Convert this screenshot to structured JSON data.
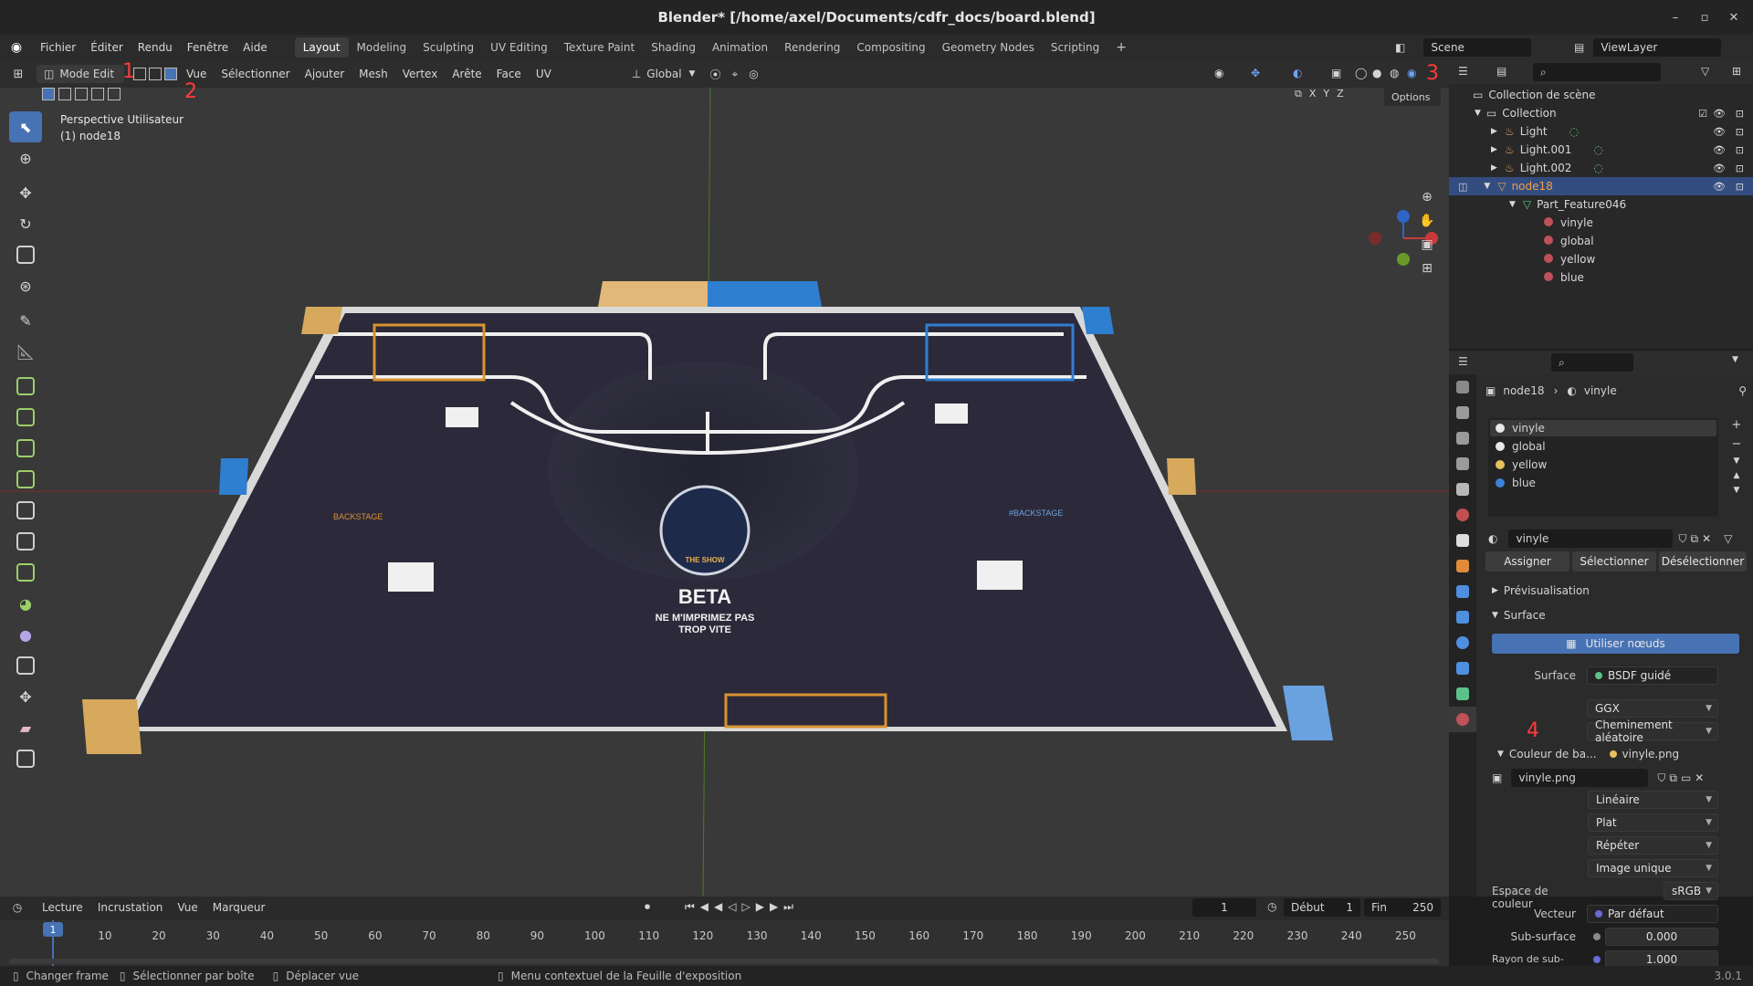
{
  "window": {
    "title": "Blender* [/home/axel/Documents/cdfr_docs/board.blend]"
  },
  "menu": [
    "Fichier",
    "Éditer",
    "Rendu",
    "Fenêtre",
    "Aide"
  ],
  "workspaces": [
    {
      "label": "Layout",
      "active": true
    },
    {
      "label": "Modeling"
    },
    {
      "label": "Sculpting"
    },
    {
      "label": "UV Editing"
    },
    {
      "label": "Texture Paint"
    },
    {
      "label": "Shading"
    },
    {
      "label": "Animation"
    },
    {
      "label": "Rendering"
    },
    {
      "label": "Compositing"
    },
    {
      "label": "Geometry Nodes"
    },
    {
      "label": "Scripting"
    }
  ],
  "scene": {
    "label": "Scene",
    "viewlayer": "ViewLayer"
  },
  "viewport_header": {
    "mode": "Mode Edit",
    "menus": [
      "Vue",
      "Sélectionner",
      "Ajouter",
      "Mesh",
      "Vertex",
      "Arête",
      "Face",
      "UV"
    ],
    "orientation": "Global",
    "options": "Options",
    "axes": [
      "X",
      "Y",
      "Z"
    ]
  },
  "viewport": {
    "perspective": "Perspective Utilisateur",
    "object": "(1) node18",
    "board_text_main": "BETA",
    "board_text_sub1": "NE M'IMPRIMEZ PAS",
    "board_text_sub2": "TROP VITE",
    "board_logo_text": "THE SHOW",
    "board_backstage_left": "BACKSTAGE",
    "board_backstage_right": "#BACKSTAGE"
  },
  "annotations": [
    "1",
    "2",
    "3",
    "4"
  ],
  "outliner": {
    "root": "Collection de scène",
    "collection": "Collection",
    "items": [
      {
        "label": "Light"
      },
      {
        "label": "Light.001"
      },
      {
        "label": "Light.002"
      },
      {
        "label": "node18",
        "selected": true
      },
      {
        "label": "Part_Feature046"
      },
      {
        "label": "vinyle"
      },
      {
        "label": "global"
      },
      {
        "label": "yellow"
      },
      {
        "label": "blue"
      }
    ]
  },
  "properties": {
    "breadcrumb_object": "node18",
    "breadcrumb_material": "vinyle",
    "slots": [
      {
        "label": "vinyle",
        "color": "#e8e8e8"
      },
      {
        "label": "global",
        "color": "#e8e8e8"
      },
      {
        "label": "yellow",
        "color": "#e6c15a"
      },
      {
        "label": "blue",
        "color": "#3b82d8"
      }
    ],
    "material_name": "vinyle",
    "assign": "Assigner",
    "select": "Sélectionner",
    "deselect": "Désélectionner",
    "preview": "Prévisualisation",
    "surface_panel": "Surface",
    "use_nodes": "Utiliser nœuds",
    "surface_label": "Surface",
    "surface_value": "BSDF guidé",
    "distribution": "GGX",
    "subsurface_method": "Cheminement aléatoire",
    "base_color_label": "Couleur de ba...",
    "base_color_value": "vinyle.png",
    "image_name": "vinyle.png",
    "interpolation": "Linéaire",
    "projection": "Plat",
    "extension": "Répéter",
    "source": "Image unique",
    "colorspace_label": "Espace de couleur",
    "colorspace_value": "sRGB",
    "vector_label": "Vecteur",
    "vector_value": "Par défaut",
    "subsurface_label": "Sub-surface",
    "subsurface_value": "0.000",
    "subsurface_radius_label": "Rayon de sub-surf...",
    "subsurface_radius_value": "1.000"
  },
  "timeline": {
    "menus": [
      "Lecture",
      "Incrustation",
      "Vue",
      "Marqueur"
    ],
    "current_frame": "1",
    "start_label": "Début",
    "start": "1",
    "end_label": "Fin",
    "end": "250",
    "ticks": [
      "1",
      "10",
      "20",
      "30",
      "40",
      "50",
      "60",
      "70",
      "80",
      "90",
      "100",
      "110",
      "120",
      "130",
      "140",
      "150",
      "160",
      "170",
      "180",
      "190",
      "200",
      "210",
      "220",
      "230",
      "240",
      "250"
    ]
  },
  "status": {
    "item1": "Changer frame",
    "item2": "Sélectionner par boîte",
    "item3": "Déplacer vue",
    "item4": "Menu contextuel de la Feuille d'exposition",
    "version": "3.0.1"
  },
  "colors": {
    "accent": "#4772b3",
    "selected_row": "#334d80",
    "board": "#2a2838",
    "board_edge": "#e6e6e6",
    "orange": "#e0a030",
    "blue": "#2f7fd0"
  }
}
